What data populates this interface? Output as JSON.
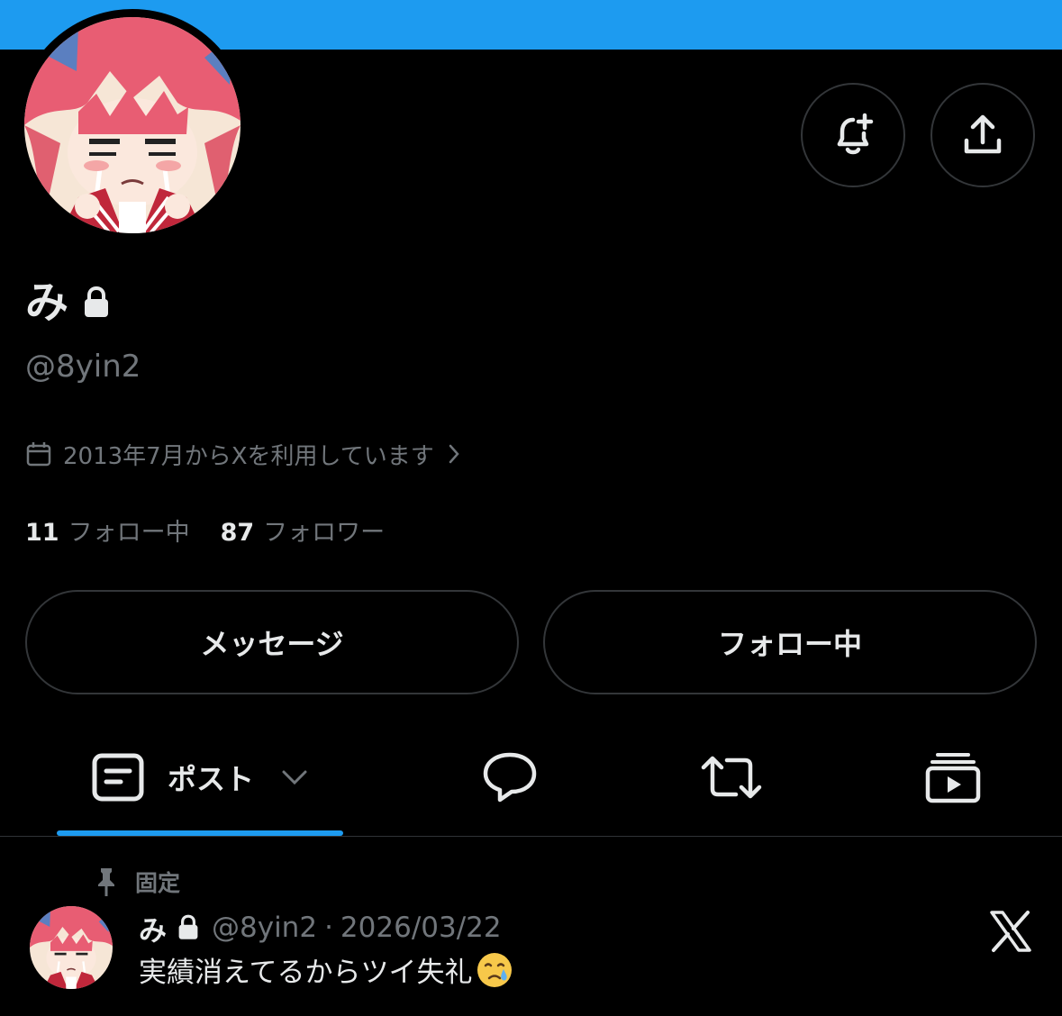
{
  "profile": {
    "display_name": "み",
    "handle": "@8yin2",
    "joined": "2013年7月からXを利用しています",
    "following_count": "11",
    "following_label": "フォロー中",
    "followers_count": "87",
    "followers_label": "フォロワー",
    "locked": true
  },
  "header": {
    "banner_color": "#1d9bf0",
    "notify_icon": "bell-plus-icon",
    "share_icon": "share-icon"
  },
  "actions": {
    "message_label": "メッセージ",
    "follow_label": "フォロー中"
  },
  "tabs": [
    {
      "label": "ポスト",
      "icon": "posts-icon",
      "active": true,
      "has_dropdown": true
    },
    {
      "label": "",
      "icon": "replies-icon",
      "active": false
    },
    {
      "label": "",
      "icon": "reposts-icon",
      "active": false
    },
    {
      "label": "",
      "icon": "videos-icon",
      "active": false
    }
  ],
  "pinned_post": {
    "pinned_label": "固定",
    "author_name": "み",
    "author_handle": "@8yin2",
    "separator": "·",
    "date": "2026/03/22",
    "text": "実績消えてるからツイ失礼",
    "emoji": "crying-face-emoji",
    "source_icon": "x-logo-icon"
  },
  "colors": {
    "background": "#000000",
    "accent": "#1d9bf0",
    "primary_text": "#e7e9ea",
    "secondary_text": "#71767b",
    "border": "#333639"
  }
}
